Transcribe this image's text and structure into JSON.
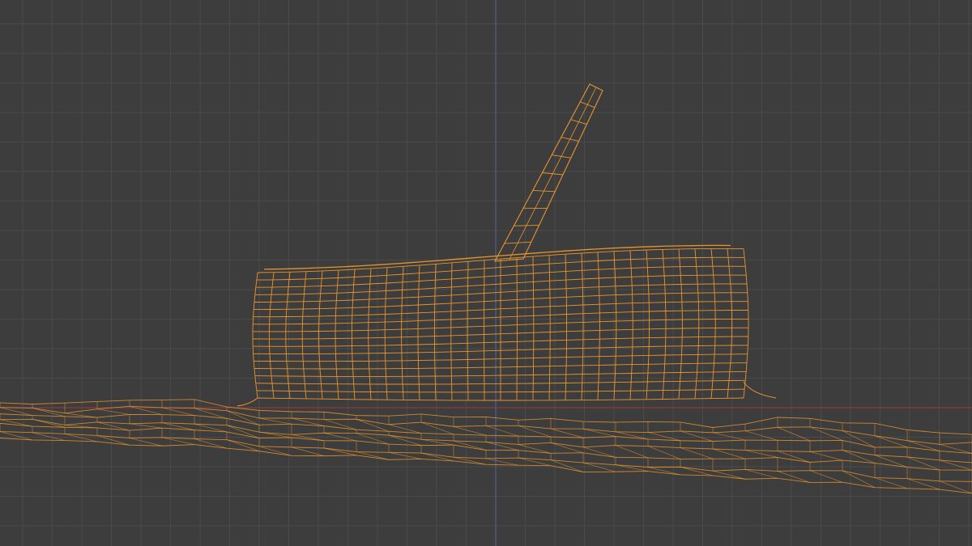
{
  "viewport": {
    "name": "3D Viewport",
    "view_mode": "wireframe",
    "background_color": "#3d3d3d",
    "grid_color": "#4a4a4a",
    "axis_x_color": "#8e3a3e",
    "axis_z_color": "#4f5e8e"
  },
  "scene": {
    "selected_objects": [
      "ground-terrain-mesh",
      "cylinder-stump-mesh",
      "handle-stick-mesh"
    ],
    "wireframe_color": "#e8952d",
    "selection_state": "selected"
  }
}
